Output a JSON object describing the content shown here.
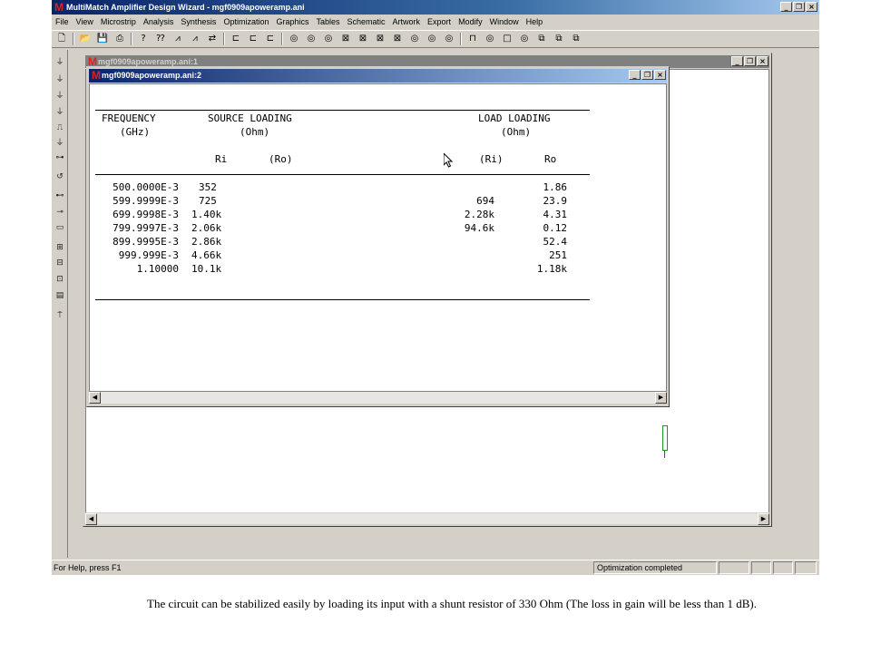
{
  "app": {
    "title": "MultiMatch Amplifier Design Wizard - mgf0909apoweramp.ani",
    "logo_glyph": "M"
  },
  "window_controls": {
    "minimize": "_",
    "restore": "❐",
    "close": "×"
  },
  "menu": [
    "File",
    "View",
    "Microstrip",
    "Analysis",
    "Synthesis",
    "Optimization",
    "Graphics",
    "Tables",
    "Schematic",
    "Artwork",
    "Export",
    "Modify",
    "Window",
    "Help"
  ],
  "toolbar_icons": [
    "new-icon",
    "open-icon",
    "save-icon",
    "print-icon",
    "help-icon",
    "context-help-icon",
    "tool-a-icon",
    "tool-b-icon",
    "tool-c-icon",
    "component-icon",
    "component-icon",
    "component-icon",
    "circle-icon",
    "circle-icon",
    "circle-icon",
    "box-icon",
    "box-icon",
    "box-icon",
    "box-icon",
    "circle-icon",
    "circle-icon",
    "circle-icon",
    "graph-icon",
    "circle-icon",
    "square-icon",
    "circle-icon",
    "network-icon",
    "network-icon",
    "network-icon"
  ],
  "child_window_1": {
    "title": "mgf0909apoweramp.ani:1"
  },
  "child_window_2": {
    "title": "mgf0909apoweramp.ani:2",
    "headers": {
      "frequency": "FREQUENCY",
      "frequency_unit": "(GHz)",
      "source_loading": "SOURCE LOADING",
      "source_unit": "(Ohm)",
      "source_ri": "Ri",
      "source_ro": "(Ro)",
      "load_loading": "LOAD LOADING",
      "load_unit": "(Ohm)",
      "load_ri": "(Ri)",
      "load_ro": "Ro"
    },
    "rows": [
      {
        "freq": "500.0000E-3",
        "src": "352",
        "load_ri": "",
        "load_ro": "1.86"
      },
      {
        "freq": "599.9999E-3",
        "src": "725",
        "load_ri": "694",
        "load_ro": "23.9"
      },
      {
        "freq": "699.9998E-3",
        "src": "1.40k",
        "load_ri": "2.28k",
        "load_ro": "4.31"
      },
      {
        "freq": "799.9997E-3",
        "src": "2.06k",
        "load_ri": "94.6k",
        "load_ro": "0.12"
      },
      {
        "freq": "899.9995E-3",
        "src": "2.86k",
        "load_ri": "",
        "load_ro": "52.4"
      },
      {
        "freq": "999.999E-3",
        "src": "4.66k",
        "load_ri": "",
        "load_ro": "251"
      },
      {
        "freq": "1.10000",
        "src": "10.1k",
        "load_ri": "",
        "load_ro": "1.18k"
      }
    ]
  },
  "status": {
    "help": "For Help, press F1",
    "message": "Optimization completed"
  },
  "caption": "The circuit can be stabilized easily by loading its input with a shunt resistor of 330 Ohm (The loss in gain will be less than 1 dB)."
}
